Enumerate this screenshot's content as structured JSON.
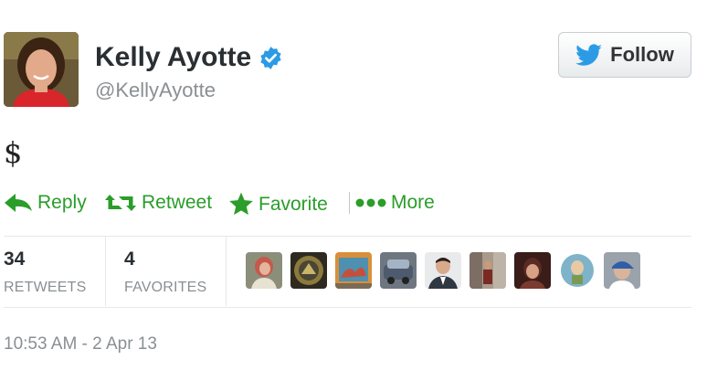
{
  "profile": {
    "name": "Kelly Ayotte",
    "handle": "@KellyAyotte",
    "verified_badge_color": "#2b9be6",
    "avatar_icon": "profile-photo"
  },
  "follow_button": {
    "label": "Follow",
    "icon": "twitter-bird-icon",
    "icon_color": "#2b9be6"
  },
  "tweet": {
    "text": "$"
  },
  "actions": [
    {
      "label": "Reply",
      "icon": "reply-arrow-icon"
    },
    {
      "label": "Retweet",
      "icon": "retweet-icon"
    },
    {
      "label": "Favorite",
      "icon": "star-icon"
    },
    {
      "label": "More",
      "icon": "more-dots-icon"
    }
  ],
  "action_color": "#2a9d2a",
  "stats": {
    "retweets": {
      "count": "34",
      "label": "RETWEETS"
    },
    "favorites": {
      "count": "4",
      "label": "FAVORITES"
    }
  },
  "favoriters": [
    {
      "icon": "user-avatar-woman-icon",
      "color": "#c7584c"
    },
    {
      "icon": "user-avatar-seal-icon",
      "color": "#8c7a3c"
    },
    {
      "icon": "user-avatar-art-icon",
      "color": "#d98f3a"
    },
    {
      "icon": "user-avatar-car-icon",
      "color": "#4e5a6e"
    },
    {
      "icon": "user-avatar-suit-icon",
      "color": "#2f3742"
    },
    {
      "icon": "user-avatar-street-icon",
      "color": "#a89a8c"
    },
    {
      "icon": "user-avatar-man-icon",
      "color": "#5a2a24"
    },
    {
      "icon": "user-avatar-cartoon-icon",
      "color": "#7fb3c9"
    },
    {
      "icon": "user-avatar-cap-icon",
      "color": "#9aa3ab"
    }
  ],
  "timestamp": "10:53 AM - 2 Apr 13"
}
